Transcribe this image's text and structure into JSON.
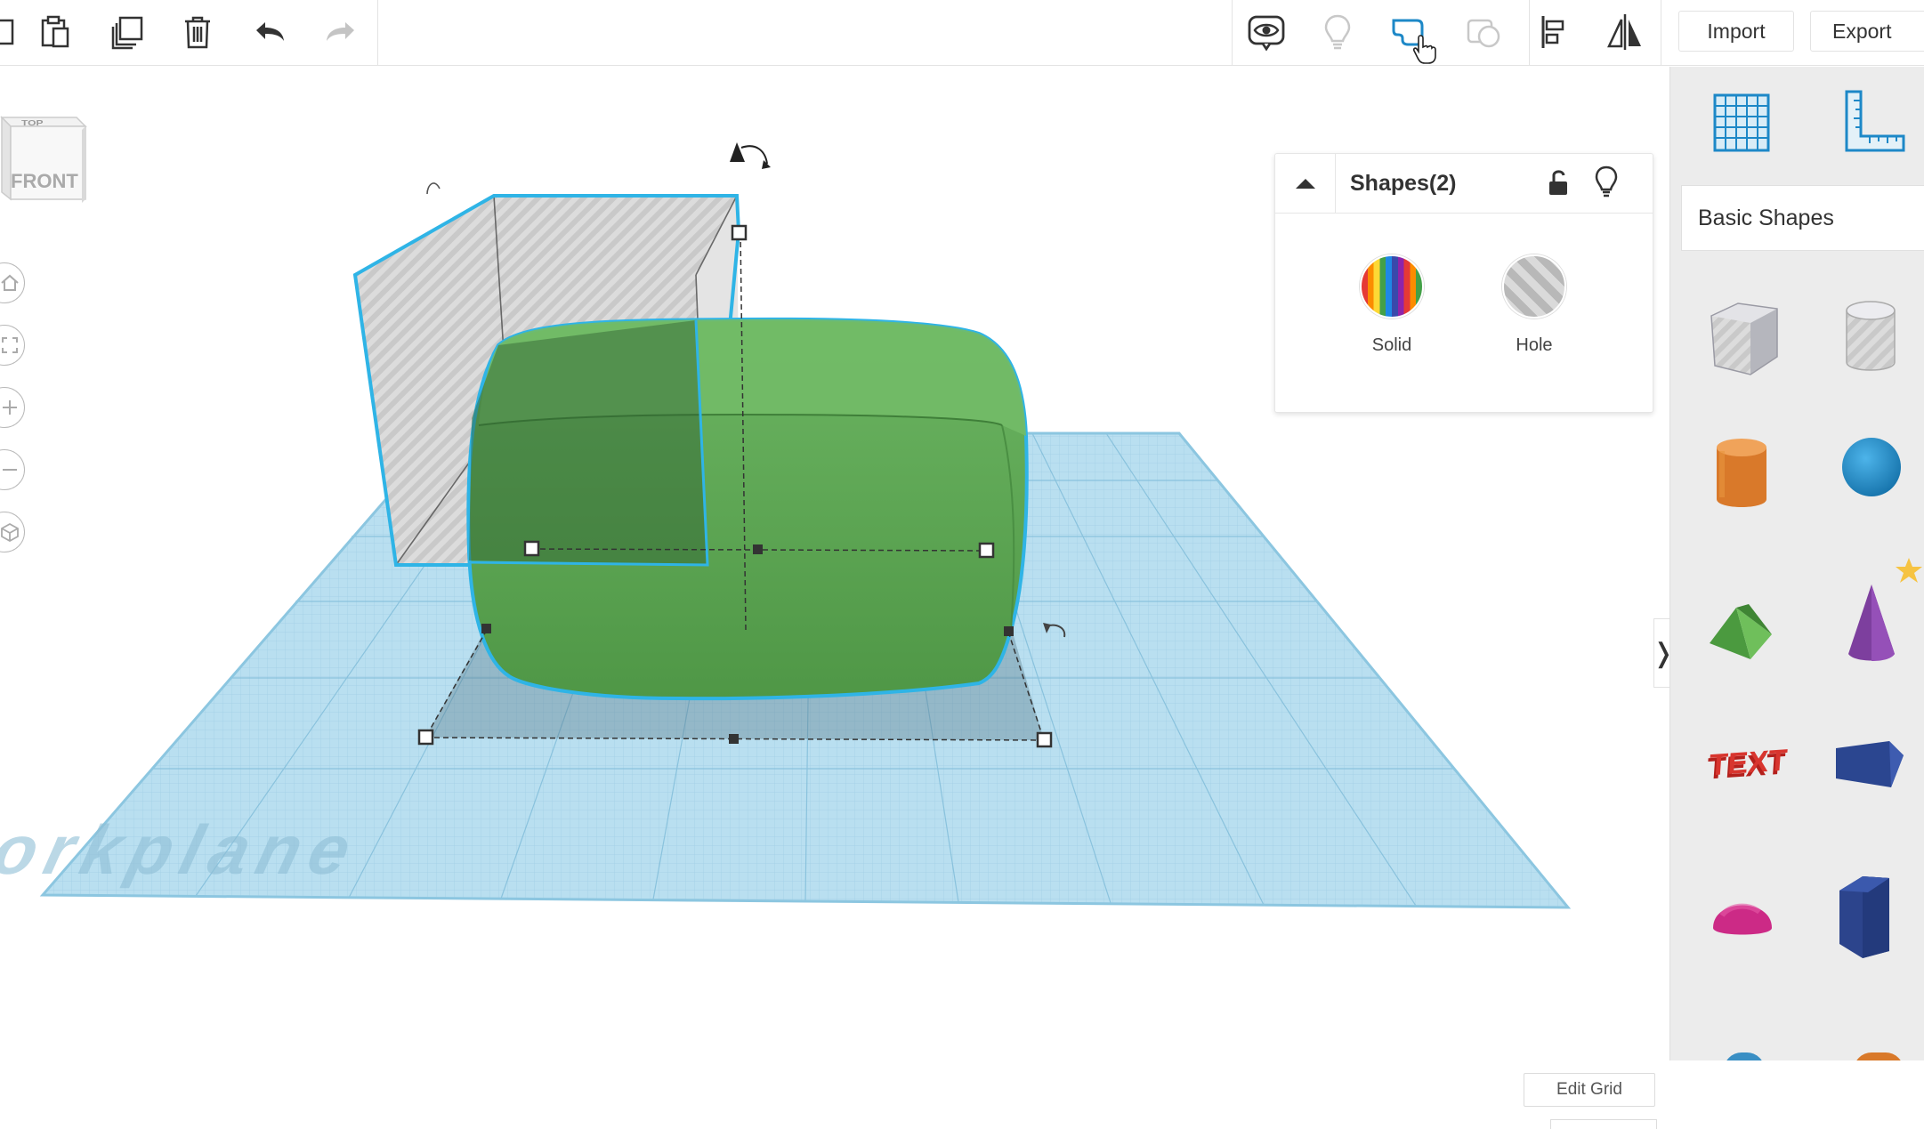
{
  "toolbar": {
    "import_label": "Import",
    "export_label": "Export",
    "buttons": [
      "paste-icon",
      "duplicate-icon",
      "delete-icon",
      "undo-icon",
      "redo-icon",
      "show-all-icon",
      "hide-icon",
      "group-icon",
      "ungroup-icon",
      "align-icon",
      "mirror-icon"
    ]
  },
  "viewcube": {
    "top_label": "TOP",
    "front_label": "FRONT"
  },
  "workplane": {
    "label": "Workplane"
  },
  "shape_panel": {
    "title": "Shapes(2)",
    "solid_label": "Solid",
    "hole_label": "Hole"
  },
  "edit_grid": {
    "label": "Edit Grid"
  },
  "expand_toggle": {
    "glyph": "❭"
  },
  "library": {
    "category": "Basic Shapes",
    "shapes": [
      "box",
      "cylinder-hole",
      "cylinder",
      "sphere",
      "roof",
      "cone",
      "text",
      "wedge",
      "half-sphere",
      "polygon"
    ]
  },
  "colors": {
    "accent": "#1d88c7",
    "workplane": "#b6dcee",
    "selection_outline": "#2fb4e6",
    "green_shape": "#5faa55",
    "toolbar_disabled": "#bbbbbb"
  }
}
